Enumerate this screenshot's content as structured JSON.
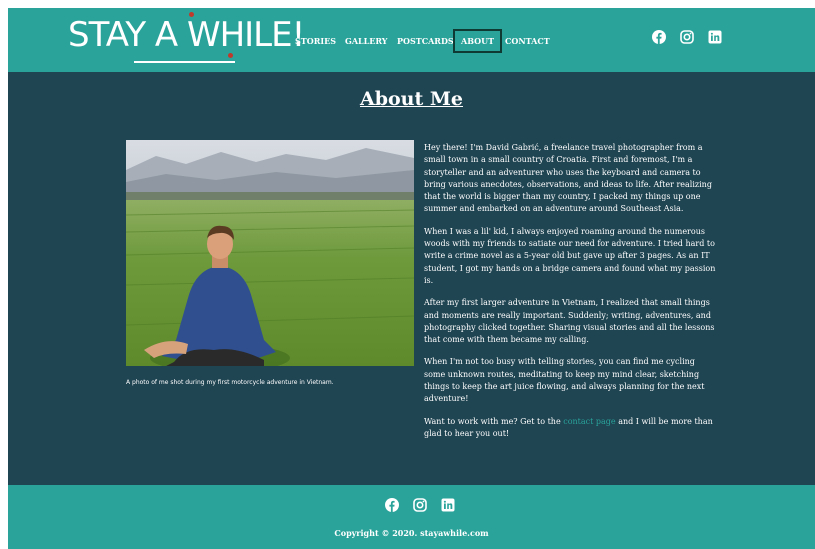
{
  "header": {
    "logo_text": "STAY A WHILE!",
    "nav": [
      {
        "label": "STORIES"
      },
      {
        "label": "GALLERY"
      },
      {
        "label": "POSTCARDS"
      },
      {
        "label": "ABOUT",
        "active": true
      },
      {
        "label": "CONTACT"
      }
    ],
    "social": [
      "facebook-icon",
      "instagram-icon",
      "linkedin-icon"
    ]
  },
  "main": {
    "title": "About Me",
    "photo_caption": "A photo of me shot during my first motorcycle adventure in Vietnam.",
    "bio": [
      "Hey there! I'm David Gabrić, a freelance travel photographer from a small town in a small country of Croatia. First and foremost, I'm a storyteller and an adventurer who uses the keyboard and camera to bring various anecdotes, observations, and ideas to life. After realizing that the world is bigger than my country, I packed my things up one summer and embarked on an adventure around Southeast Asia.",
      "When I was a lil' kid, I always enjoyed roaming around the numerous woods with my friends to satiate our need for adventure. I tried hard to write a crime novel as a 5-year old but gave up after 3 pages. As an IT student, I got my hands on a bridge camera and found what my passion is.",
      "After my first larger adventure in Vietnam, I realized that small things and moments are really important. Suddenly; writing, adventures, and photography clicked together. Sharing visual stories and all the lessons that come with them became my calling.",
      "When I'm not too busy with telling stories, you can find me cycling some unknown routes, meditating to keep my mind clear, sketching things to keep the art juice flowing, and always planning for the next adventure!"
    ],
    "contact_prefix": "Want to work with me? Get to the ",
    "contact_link": "contact page",
    "contact_suffix": " and I will be more than glad to hear you out!"
  },
  "footer": {
    "social": [
      "facebook-icon",
      "instagram-icon",
      "linkedin-icon"
    ],
    "copyright": "Copyright © 2020. stayawhile.com"
  },
  "colors": {
    "header_bg": "#2aa39a",
    "main_bg": "#1f4452",
    "link": "#2aa39a",
    "logo_dot": "#c0392b"
  }
}
